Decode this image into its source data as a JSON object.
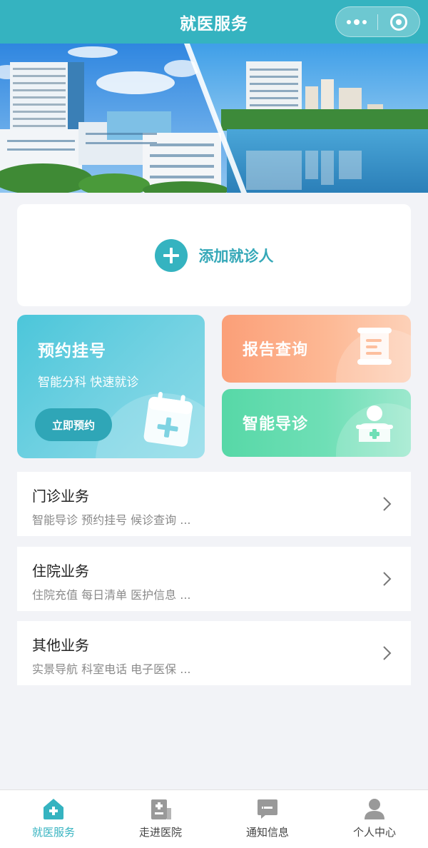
{
  "nav": {
    "title": "就医服务",
    "menu_icon": "more-dots-icon",
    "close_icon": "target-icon"
  },
  "banner": {
    "alt": "hospital-photo"
  },
  "add_patient": {
    "label": "添加就诊人",
    "icon": "plus-circle-icon"
  },
  "cards": {
    "booking": {
      "title": "预约挂号",
      "subtitle": "智能分科 快速就诊",
      "button": "立即预约",
      "icon": "calendar-plus-icon"
    },
    "report": {
      "title": "报告查询",
      "icon": "scroll-document-icon"
    },
    "guide": {
      "title": "智能导诊",
      "icon": "doctor-icon"
    }
  },
  "business": [
    {
      "name": "门诊业务",
      "desc": "智能导诊 预约挂号 候诊查询 ..."
    },
    {
      "name": "住院业务",
      "desc": "住院充值 每日清单 医护信息 ..."
    },
    {
      "name": "其他业务",
      "desc": "实景导航 科室电话 电子医保 ..."
    }
  ],
  "tabbar": [
    {
      "label": "就医服务",
      "icon": "home-plus-icon",
      "active": true
    },
    {
      "label": "走进医院",
      "icon": "hospital-building-icon",
      "active": false
    },
    {
      "label": "通知信息",
      "icon": "message-icon",
      "active": false
    },
    {
      "label": "个人中心",
      "icon": "user-icon",
      "active": false
    }
  ],
  "colors": {
    "primary": "#35b3c0",
    "report": "#fb9f78",
    "guide": "#57d8a7",
    "background": "#f2f3f7"
  }
}
